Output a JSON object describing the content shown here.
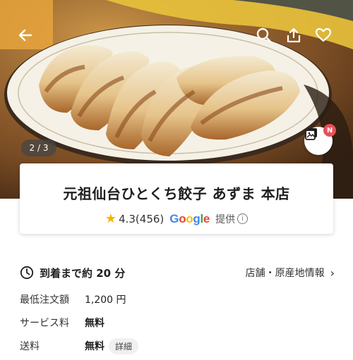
{
  "hero": {
    "pager": "2 / 3",
    "photo_badge": "N"
  },
  "icons": {
    "back": "back-arrow-icon",
    "search": "search-icon",
    "share": "share-icon",
    "favorite": "heart-icon",
    "photos": "photo-gallery-icon",
    "clock": "clock-icon",
    "info": "info-icon",
    "chevron": "chevron-right-icon"
  },
  "store": {
    "name": "元祖仙台ひとくち餃子 あずま 本店",
    "rating": "4.3",
    "review_count": "(456)",
    "provider_logo": "Google",
    "provided_label": "提供"
  },
  "details": {
    "eta": "到着まで約 20 分",
    "store_info_link": "店舗・原産地情報",
    "min_order_label": "最低注文額",
    "min_order_value": "1,200 円",
    "service_fee_label": "サービス料",
    "service_fee_value": "無料",
    "delivery_fee_label": "送料",
    "delivery_fee_value": "無料",
    "delivery_fee_detail": "詳細"
  },
  "colors": {
    "star": "#f4b400",
    "badge": "#e8505b",
    "google_blue": "#4285f4",
    "google_red": "#ea4335",
    "google_yellow": "#fbbc05",
    "google_green": "#34a853"
  }
}
